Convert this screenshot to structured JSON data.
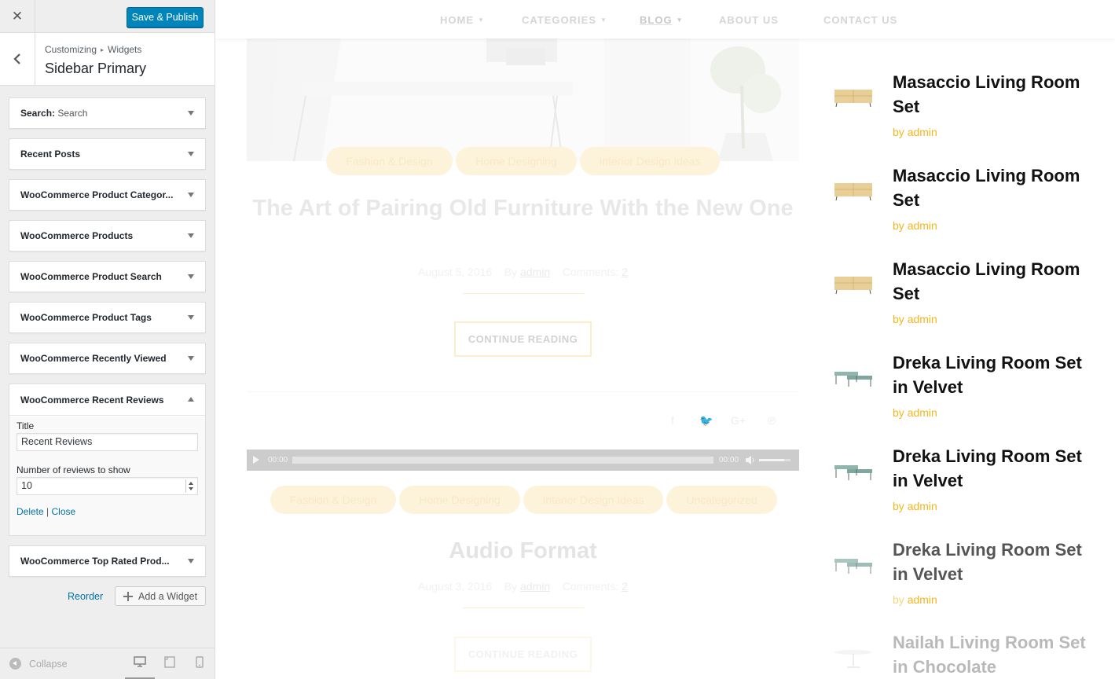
{
  "customizer": {
    "close_icon": "close-icon",
    "publish_label": "Save & Publish",
    "breadcrumb": [
      "Customizing",
      "Widgets"
    ],
    "section_title": "Sidebar Primary",
    "widgets": [
      {
        "label": "Search:",
        "sub": " Search"
      },
      {
        "label": "Recent Posts",
        "sub": ""
      },
      {
        "label": "WooCommerce Product Categor...",
        "sub": ""
      },
      {
        "label": "WooCommerce Products",
        "sub": ""
      },
      {
        "label": "WooCommerce Product Search",
        "sub": ""
      },
      {
        "label": "WooCommerce Product Tags",
        "sub": ""
      },
      {
        "label": "WooCommerce Recently Viewed",
        "sub": ""
      }
    ],
    "expanded_widget": {
      "label": "WooCommerce Recent Reviews",
      "title_label": "Title",
      "title_value": "Recent Reviews",
      "count_label": "Number of reviews to show",
      "count_value": "10",
      "delete_label": "Delete",
      "separator": "|",
      "close_label": "Close"
    },
    "last_widget": {
      "label": "WooCommerce Top Rated Prod..."
    },
    "reorder_label": "Reorder",
    "add_widget_label": "Add a Widget",
    "collapse_label": "Collapse"
  },
  "preview": {
    "nav": [
      {
        "label": "HOME",
        "dropdown": true
      },
      {
        "label": "CATEGORIES",
        "dropdown": true
      },
      {
        "label": "BLOG",
        "dropdown": true
      },
      {
        "label": "ABOUT US",
        "dropdown": false
      },
      {
        "label": "CONTACT US",
        "dropdown": false
      }
    ],
    "post1": {
      "tags": [
        "Fashion & Design",
        "Home Designing",
        "Interior Design Ideas"
      ],
      "title": "The Art of Pairing Old Furniture With the New One",
      "date": "August 5, 2016",
      "by_label": "By",
      "author": "admin",
      "comments_label": "Comments:",
      "comments": "2",
      "continue_label": "CONTINUE READING"
    },
    "share_icons": [
      "facebook-icon",
      "twitter-icon",
      "google-plus-icon",
      "pinterest-icon"
    ],
    "player": {
      "current": "00:00",
      "duration": "00:00"
    },
    "post2": {
      "tags": [
        "Fashion & Design",
        "Home Designing",
        "Interior Design Ideas",
        "Uncategorized"
      ],
      "title": "Audio Format",
      "date": "August 3, 2016",
      "by_label": "By",
      "author": "admin",
      "comments_label": "Comments:",
      "comments": "2",
      "continue_label": "CONTINUE READING"
    },
    "reviews": [
      {
        "title": "Masaccio Living Room Set",
        "by": "by",
        "author": "admin",
        "thumb": "sideboard"
      },
      {
        "title": "Masaccio Living Room Set",
        "by": "by",
        "author": "admin",
        "thumb": "sideboard"
      },
      {
        "title": "Masaccio Living Room Set",
        "by": "by",
        "author": "admin",
        "thumb": "sideboard"
      },
      {
        "title": "Dreka Living Room Set in Velvet",
        "by": "by",
        "author": "admin",
        "thumb": "bench"
      },
      {
        "title": "Dreka Living Room Set in Velvet",
        "by": "by",
        "author": "admin",
        "thumb": "bench"
      },
      {
        "title": "Dreka Living Room Set in Velvet",
        "by": "by",
        "author": "admin",
        "thumb": "bench"
      },
      {
        "title": "Nailah Living Room Set in Chocolate",
        "by": "",
        "author": "",
        "thumb": "table"
      }
    ]
  },
  "colors": {
    "primary_button": "#0085ba",
    "link": "#0073aa",
    "accent": "#f3b71d"
  }
}
